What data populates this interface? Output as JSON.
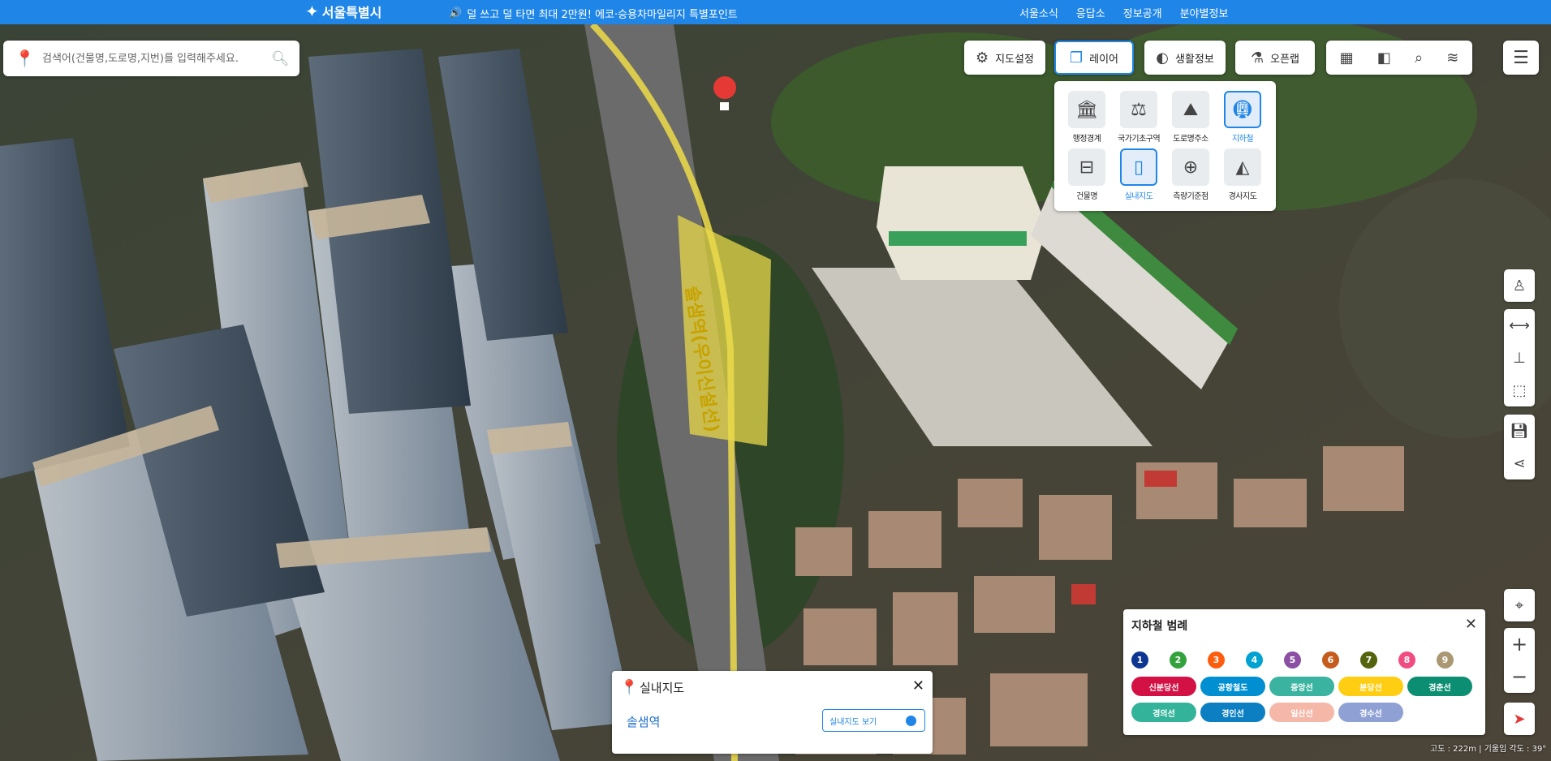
{
  "header": {
    "logo": "서울특별시",
    "notice": "덜 쓰고 덜 타면 최대 2만원! 에코·승용차마일리지 특별포인트",
    "nav": [
      "서울소식",
      "응답소",
      "정보공개",
      "분야별정보"
    ]
  },
  "search": {
    "placeholder": "검색어(건물명,도로명,지번)를 입력해주세요."
  },
  "toolbar": {
    "map_settings": "지도설정",
    "layer": "레이어",
    "life_info": "생활정보",
    "open_map": "오픈랩"
  },
  "layers": [
    {
      "label": "행정경계",
      "icon": "government-building-icon",
      "selected": false
    },
    {
      "label": "국가기초구역",
      "icon": "scales-icon",
      "selected": false
    },
    {
      "label": "도로명주소",
      "icon": "road-address-icon",
      "selected": false
    },
    {
      "label": "지하철",
      "icon": "subway-train-icon",
      "selected": true
    },
    {
      "label": "건물명",
      "icon": "signboard-icon",
      "selected": false
    },
    {
      "label": "실내지도",
      "icon": "door-icon",
      "selected": true
    },
    {
      "label": "측량기준점",
      "icon": "crosshair-icon",
      "selected": false
    },
    {
      "label": "경사지도",
      "icon": "slope-icon",
      "selected": false
    }
  ],
  "map": {
    "station_label": "솔샘역(우이신설선)"
  },
  "subway_legend": {
    "title": "지하철 범례",
    "numbered_lines": [
      {
        "label": "1",
        "color": "#0d3692"
      },
      {
        "label": "2",
        "color": "#33a23d"
      },
      {
        "label": "3",
        "color": "#fe5d10"
      },
      {
        "label": "4",
        "color": "#00a2d1"
      },
      {
        "label": "5",
        "color": "#8b50a4"
      },
      {
        "label": "6",
        "color": "#c55c1d"
      },
      {
        "label": "7",
        "color": "#54640d"
      },
      {
        "label": "8",
        "color": "#f14c82"
      },
      {
        "label": "9",
        "color": "#aa9872"
      }
    ],
    "named_lines": [
      {
        "label": "신분당선",
        "color": "#d31145"
      },
      {
        "label": "공항철도",
        "color": "#0090d2"
      },
      {
        "label": "중앙선",
        "color": "#3ab4a0"
      },
      {
        "label": "분당선",
        "color": "#ffcd12"
      },
      {
        "label": "경춘선",
        "color": "#0c8e72"
      },
      {
        "label": "경의선",
        "color": "#33b39a"
      },
      {
        "label": "경인선",
        "color": "#0b7fc2"
      },
      {
        "label": "일산선",
        "color": "#f4b7a8"
      },
      {
        "label": "경수선",
        "color": "#8fa1d4"
      }
    ]
  },
  "indoor_panel": {
    "title": "실내지도",
    "station": "솔샘역",
    "view_button": "실내지도 보기"
  },
  "status_bar": {
    "text": "고도 : 222m | 기울임 각도 : 39°"
  }
}
